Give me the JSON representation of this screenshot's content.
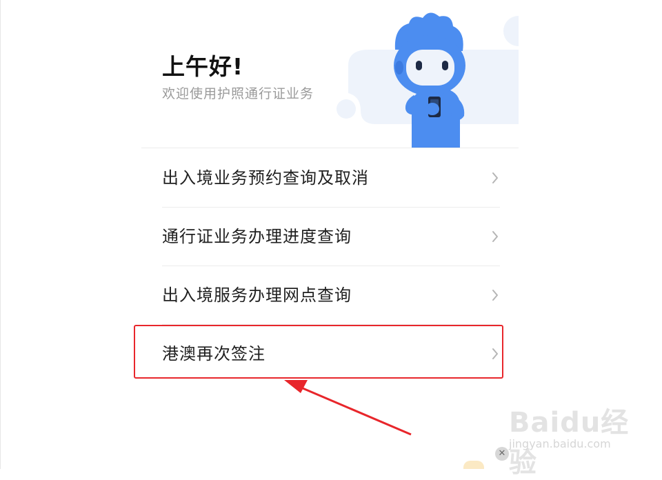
{
  "header": {
    "greeting": "上午好!",
    "subtitle": "欢迎使用护照通行证业务"
  },
  "menu": {
    "items": [
      {
        "label": "出入境业务预约查询及取消"
      },
      {
        "label": "通行证业务办理进度查询"
      },
      {
        "label": "出入境服务办理网点查询"
      },
      {
        "label": "港澳再次签注"
      }
    ]
  },
  "annotation": {
    "highlighted_item": "港澳再次签注",
    "highlight_color": "#e8262b"
  },
  "watermark": {
    "logo": "Baidu经验",
    "url": "jingyan.baidu.com"
  },
  "colors": {
    "mascot_blue": "#4c8df0",
    "hero_bg": "#eef3fb",
    "text_primary": "#1f1f1f",
    "text_secondary": "#9a9a9a"
  },
  "icons": {
    "menu_chevron": "chevron-right-icon",
    "close": "close-icon"
  }
}
